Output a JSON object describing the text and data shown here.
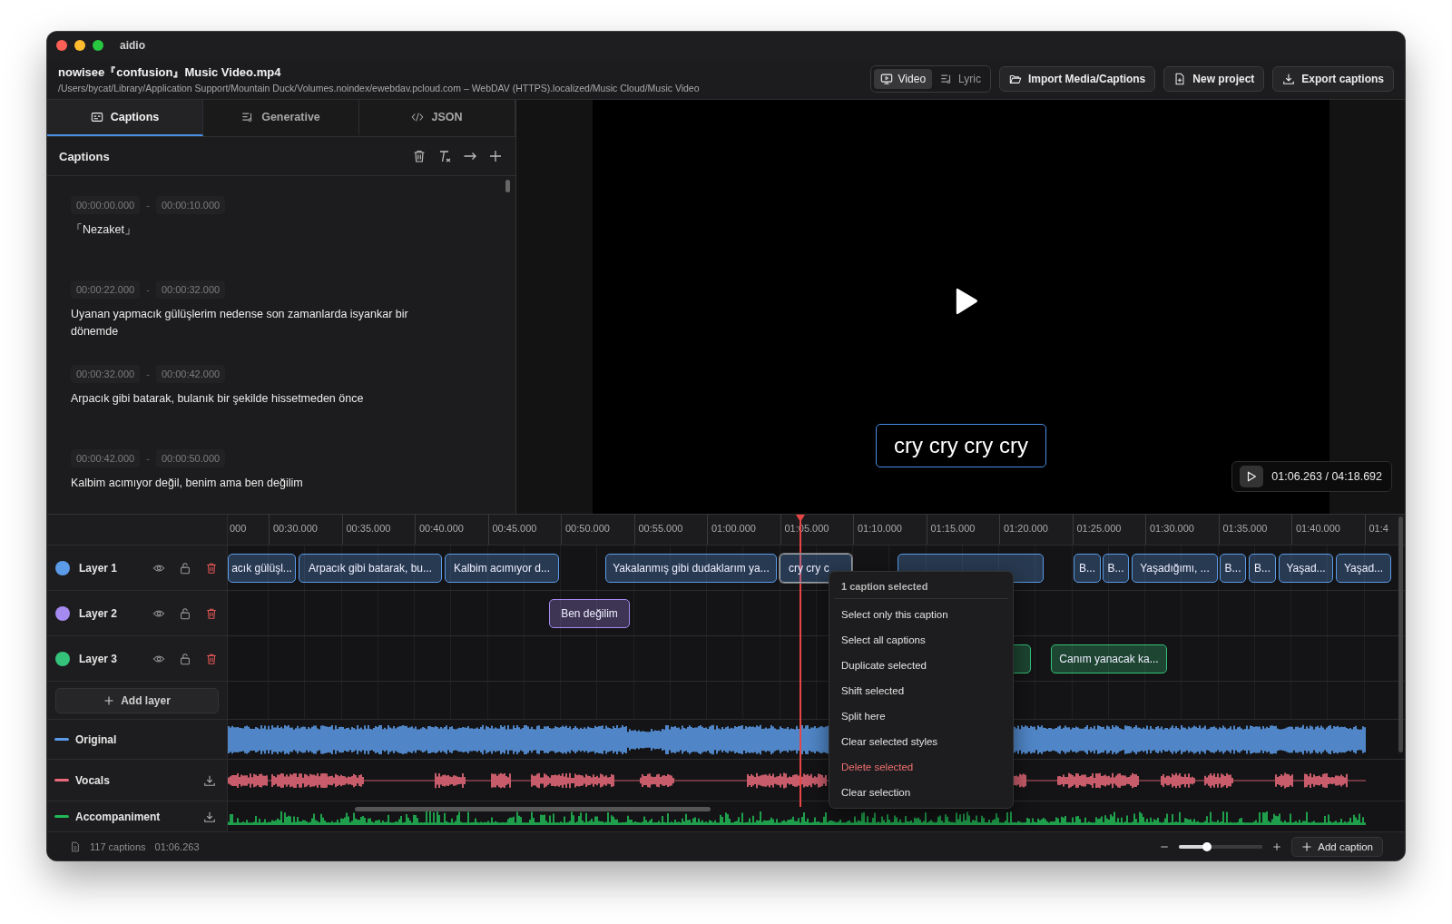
{
  "window": {
    "title": "aidio"
  },
  "header": {
    "file_name": "nowisee『confusion』Music Video.mp4",
    "path": "/Users/bycat/Library/Application Support/Mountain Duck/Volumes.noindex/ewebdav.pcloud.com – WebDAV (HTTPS).localized/Music Cloud/Music Video",
    "view_modes": [
      {
        "label": "Video",
        "kind": "video",
        "selected": true
      },
      {
        "label": "Lyric",
        "kind": "lyric",
        "selected": false
      }
    ],
    "buttons": [
      {
        "label": "Import Media/Captions",
        "kind": "import"
      },
      {
        "label": "New project",
        "kind": "new"
      },
      {
        "label": "Export captions",
        "kind": "export"
      }
    ]
  },
  "sidebar": {
    "tabs": [
      {
        "label": "Captions",
        "kind": "captions",
        "selected": true
      },
      {
        "label": "Generative",
        "kind": "generative",
        "selected": false
      },
      {
        "label": "JSON",
        "kind": "json",
        "selected": false
      }
    ],
    "panel_title": "Captions",
    "captions": [
      {
        "start": "00:00:00.000",
        "separator": "-",
        "end": "00:00:10.000",
        "text": "「Nezaket」"
      },
      {
        "start": "00:00:22.000",
        "separator": "-",
        "end": "00:00:32.000",
        "text": "Uyanan yapmacık gülüşlerim nedense son zamanlarda isyankar bir dönemde"
      },
      {
        "start": "00:00:32.000",
        "separator": "-",
        "end": "00:00:42.000",
        "text": "Arpacık gibi batarak, bulanık bir şekilde hissetmeden önce"
      },
      {
        "start": "00:00:42.000",
        "separator": "-",
        "end": "00:00:50.000",
        "text": "Kalbim acımıyor değil, benim ama ben değilim"
      }
    ]
  },
  "video": {
    "caption": "cry cry cry cry",
    "time": "01:06.263 / 04:18.692"
  },
  "timeline": {
    "ruler": [
      "000",
      "00:30.000",
      "00:35.000",
      "00:40.000",
      "00:45.000",
      "00:50.000",
      "00:55.000",
      "01:00.000",
      "01:05.000",
      "01:10.000",
      "01:15.000",
      "01:20.000",
      "01:25.000",
      "01:30.000",
      "01:35.000",
      "01:40.000",
      "01:4"
    ],
    "layers": [
      {
        "name": "Layer 1",
        "color": "#5b9be8",
        "clips": [
          {
            "text": "acık gülüşl...",
            "selected": false
          },
          {
            "text": "Arpacık gibi batarak, bu...",
            "selected": false
          },
          {
            "text": "Kalbim acımıyor d...",
            "selected": false
          },
          {
            "text": "Yakalanmış gibi dudaklarım ya...",
            "selected": false
          },
          {
            "text": "cry cry c",
            "selected": true
          },
          {
            "selected": false
          },
          {
            "text": "B...",
            "selected": false
          },
          {
            "text": "B...",
            "selected": false
          },
          {
            "text": "Yaşadığımı, ...",
            "selected": false
          },
          {
            "text": "B...",
            "selected": false
          },
          {
            "text": "B...",
            "selected": false
          },
          {
            "text": "Yaşad...",
            "selected": false
          },
          {
            "text": "Yaşad...",
            "selected": false
          }
        ]
      },
      {
        "name": "Layer 2",
        "color": "#a58af0",
        "clips": [
          {
            "text": "Ben değilim",
            "selected": false
          }
        ]
      },
      {
        "name": "Layer 3",
        "color": "#34c27a",
        "clips": [
          {
            "selected": false
          },
          {
            "text": "Canım yanacak ka...",
            "selected": false
          }
        ]
      }
    ],
    "add_layer": "Add layer",
    "tracks": [
      {
        "name": "Original",
        "color": "#5b9be8",
        "kind": "full",
        "download": false
      },
      {
        "name": "Vocals",
        "color": "#e8697a",
        "kind": "gapped",
        "download": true
      },
      {
        "name": "Accompaniment",
        "color": "#22b856",
        "kind": "low",
        "download": true
      }
    ],
    "context_menu": {
      "title": "1 caption selected",
      "items": [
        {
          "label": "Select only this caption",
          "kind": "normal"
        },
        {
          "label": "Select all captions",
          "kind": "normal"
        },
        {
          "label": "Duplicate selected",
          "kind": "normal"
        },
        {
          "label": "Shift selected",
          "kind": "normal"
        },
        {
          "label": "Split here",
          "kind": "normal"
        },
        {
          "label": "Clear selected styles",
          "kind": "normal"
        },
        {
          "label": "Delete selected",
          "kind": "danger"
        },
        {
          "label": "Clear selection",
          "kind": "normal"
        }
      ]
    }
  },
  "status_bar": {
    "count": "117 captions",
    "time": "01:06.263",
    "zoom": {
      "level": 0.33
    },
    "add_caption": "Add caption"
  }
}
